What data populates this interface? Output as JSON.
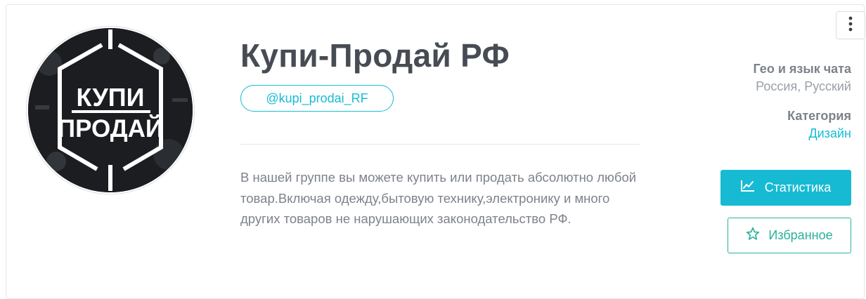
{
  "channel": {
    "title": "Купи-Продай РФ",
    "username": "@kupi_prodai_RF",
    "description": "В нашей группе вы можете купить или продать абсолютно любой товар.Включая одежду,бытовую технику,электронику и много других товаров не нарушающих законодательство РФ.",
    "avatar": {
      "line1": "КУПИ",
      "line2": "ПРОДАЙ"
    }
  },
  "meta": {
    "geo_label": "Гео и язык чата",
    "geo_value": "Россия, Русский",
    "category_label": "Категория",
    "category_value": "Дизайн"
  },
  "actions": {
    "stats_label": "Статистика",
    "favorite_label": "Избранное"
  },
  "icons": {
    "more": "more-vertical-icon",
    "stats": "line-chart-icon",
    "favorite": "star-outline-icon"
  },
  "colors": {
    "accent": "#17bad3",
    "favorite": "#28b29b",
    "title": "#474c54"
  }
}
